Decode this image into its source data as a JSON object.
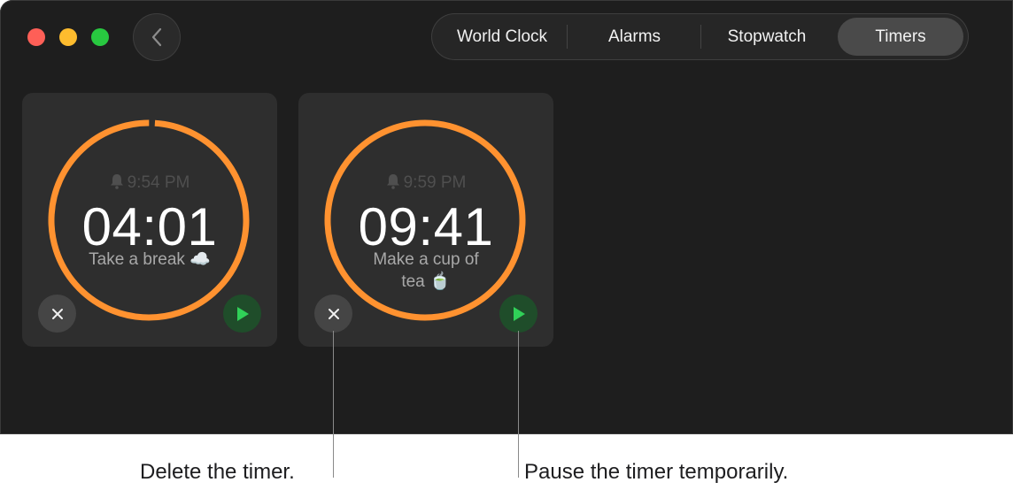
{
  "tabs": [
    "World Clock",
    "Alarms",
    "Stopwatch",
    "Timers"
  ],
  "timers": [
    {
      "alarm_time": "9:54 PM",
      "countdown": "04:01",
      "label": "Take a break ☁️",
      "progress": 0.99
    },
    {
      "alarm_time": "9:59 PM",
      "countdown": "09:41",
      "label": "Make a cup of tea 🍵",
      "progress": 1.0
    }
  ],
  "callouts": {
    "delete": "Delete the timer.",
    "pause": "Pause the timer temporarily."
  },
  "colors": {
    "ring": "#ff9230",
    "play": "#30d158",
    "selected_tab": "#4a4a4a"
  }
}
